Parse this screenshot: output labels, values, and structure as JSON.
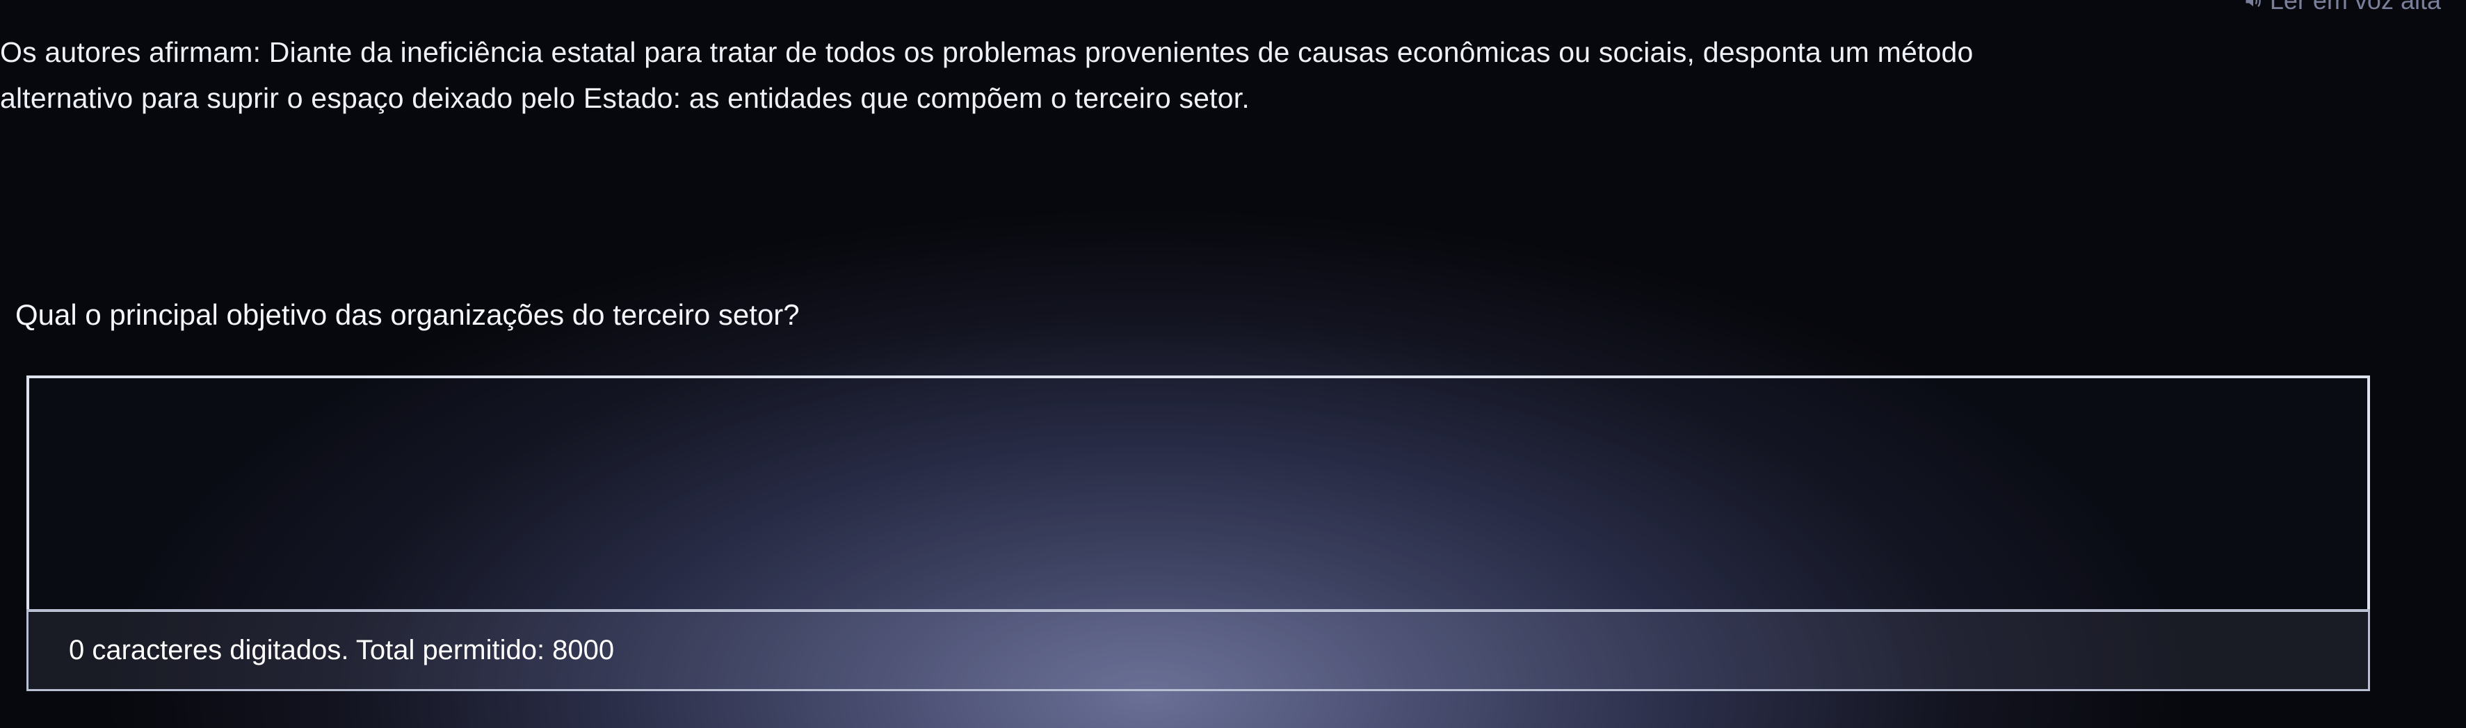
{
  "header": {
    "read_aloud_label": "Ler em voz alta"
  },
  "intro": {
    "line1": "Os autores afirmam: Diante da ineficiência estatal para tratar de todos os problemas provenientes de causas econômicas ou sociais, desponta um método",
    "line2": "alternativo para suprir o espaço deixado pelo Estado: as entidades que compõem o terceiro setor."
  },
  "question": {
    "text": "Qual o principal objetivo das organizações do terceiro setor?"
  },
  "answer": {
    "value": "",
    "counter_text": "0 caracteres digitados. Total permitido: 8000"
  }
}
